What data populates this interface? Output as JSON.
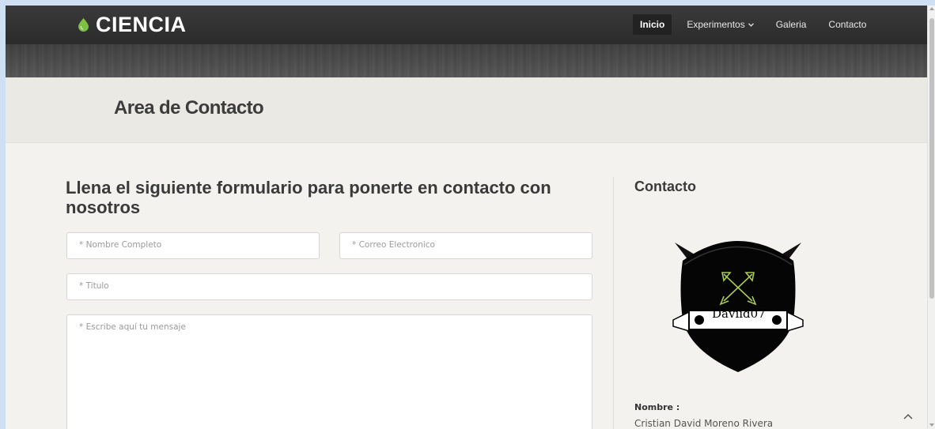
{
  "navbar": {
    "brand": "CIENCIA",
    "items": [
      {
        "label": "Inicio",
        "active": true
      },
      {
        "label": "Experimentos",
        "dropdown": true
      },
      {
        "label": "Galeria"
      },
      {
        "label": "Contacto"
      }
    ]
  },
  "header": {
    "title": "Area de Contacto"
  },
  "form": {
    "heading": "Llena el siguiente formulario para ponerte en contacto con nosotros",
    "name_placeholder": "* Nombre Completo",
    "email_placeholder": "* Correo Electronico",
    "title_placeholder": "* Titulo",
    "message_placeholder": "* Escribe aquí tu mensaje"
  },
  "sidebar": {
    "heading": "Contacto",
    "crest_text": "Daviid07",
    "name_label": "Nombre :",
    "name_value": "Cristian David Moreno Rivera"
  },
  "colors": {
    "brand_drop": "#7cc142",
    "navbar": "#2f2f2f"
  },
  "icons": [
    "drop-icon",
    "chevron-down-icon",
    "arrow-up-icon"
  ]
}
